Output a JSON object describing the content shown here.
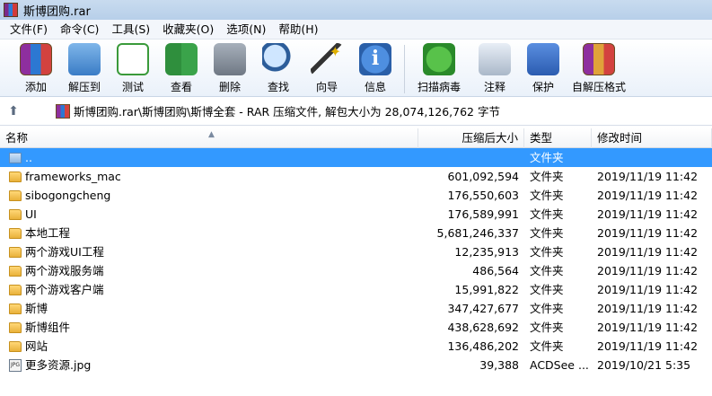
{
  "window": {
    "title": "斯博团购.rar"
  },
  "menu": [
    "文件(F)",
    "命令(C)",
    "工具(S)",
    "收藏夹(O)",
    "选项(N)",
    "帮助(H)"
  ],
  "toolbar": {
    "add": "添加",
    "extract": "解压到",
    "test": "测试",
    "view": "查看",
    "delete": "删除",
    "find": "查找",
    "wizard": "向导",
    "info": "信息",
    "scan": "扫描病毒",
    "comment": "注释",
    "protect": "保护",
    "sfx": "自解压格式"
  },
  "address": {
    "path": "斯博团购.rar\\斯博团购\\斯博全套 - RAR 压缩文件, 解包大小为 28,074,126,762 字节"
  },
  "columns": {
    "name": "名称",
    "size": "压缩后大小",
    "type": "类型",
    "date": "修改时间"
  },
  "rows": [
    {
      "name": "..",
      "size": "",
      "type": "文件夹",
      "date": ""
    },
    {
      "name": "frameworks_mac",
      "size": "601,092,594",
      "type": "文件夹",
      "date": "2019/11/19 11:42"
    },
    {
      "name": "sibogongcheng",
      "size": "176,550,603",
      "type": "文件夹",
      "date": "2019/11/19 11:42"
    },
    {
      "name": "UI",
      "size": "176,589,991",
      "type": "文件夹",
      "date": "2019/11/19 11:42"
    },
    {
      "name": "本地工程",
      "size": "5,681,246,337",
      "type": "文件夹",
      "date": "2019/11/19 11:42"
    },
    {
      "name": "两个游戏UI工程",
      "size": "12,235,913",
      "type": "文件夹",
      "date": "2019/11/19 11:42"
    },
    {
      "name": "两个游戏服务端",
      "size": "486,564",
      "type": "文件夹",
      "date": "2019/11/19 11:42"
    },
    {
      "name": "两个游戏客户端",
      "size": "15,991,822",
      "type": "文件夹",
      "date": "2019/11/19 11:42"
    },
    {
      "name": "斯博",
      "size": "347,427,677",
      "type": "文件夹",
      "date": "2019/11/19 11:42"
    },
    {
      "name": "斯博组件",
      "size": "438,628,692",
      "type": "文件夹",
      "date": "2019/11/19 11:42"
    },
    {
      "name": "网站",
      "size": "136,486,202",
      "type": "文件夹",
      "date": "2019/11/19 11:42"
    },
    {
      "name": "更多资源.jpg",
      "size": "39,388",
      "type": "ACDSee ...",
      "date": "2019/10/21 5:35"
    }
  ]
}
